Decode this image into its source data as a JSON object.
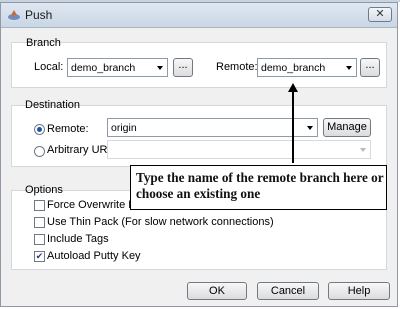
{
  "window": {
    "title": "Push",
    "close_glyph": "✕"
  },
  "branch": {
    "label": "Branch",
    "local_label": "Local:",
    "local_value": "demo_branch",
    "browse_glyph": "...",
    "remote_label": "Remote:",
    "remote_value": "demo_branch"
  },
  "destination": {
    "label": "Destination",
    "remote_radio_label": "Remote:",
    "remote_value": "origin",
    "manage_label": "Manage",
    "url_radio_label": "Arbitrary URL:",
    "url_value": ""
  },
  "options": {
    "label": "Options",
    "items": [
      {
        "label": "Force Overwrite Exist",
        "checked": false
      },
      {
        "label": "Use Thin Pack (For slow network connections)",
        "checked": false
      },
      {
        "label": "Include Tags",
        "checked": false
      },
      {
        "label": "Autoload Putty Key",
        "checked": true
      }
    ],
    "check_glyph": "✔"
  },
  "buttons": {
    "ok": "OK",
    "cancel": "Cancel",
    "help": "Help"
  },
  "callout": {
    "text": "Type the name of the remote branch here or choose an existing one"
  }
}
